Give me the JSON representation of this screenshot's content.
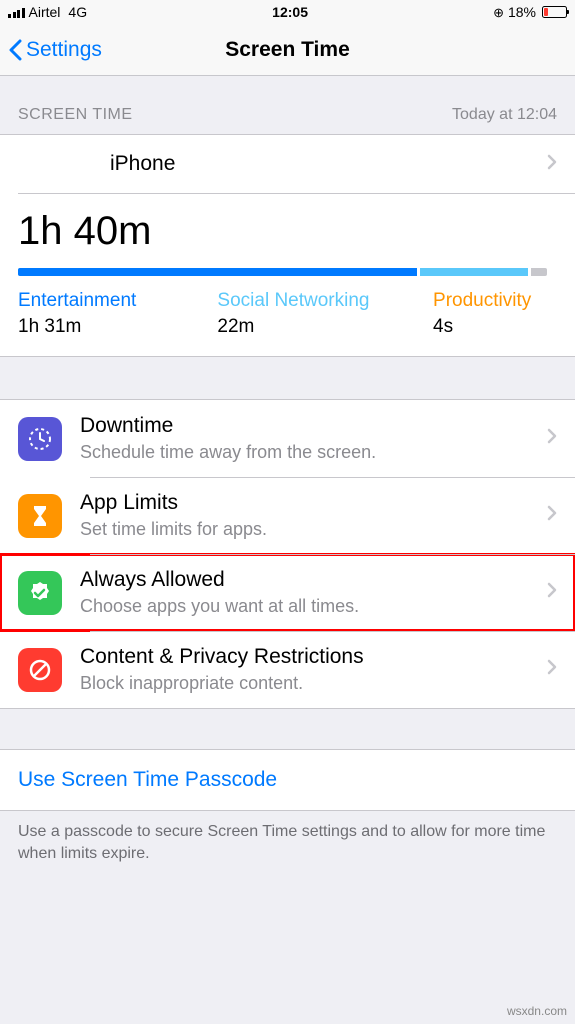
{
  "status": {
    "carrier": "Airtel",
    "network": "4G",
    "time": "12:05",
    "battery_pct": "18%"
  },
  "nav": {
    "back_label": "Settings",
    "title": "Screen Time"
  },
  "summary": {
    "header_left": "SCREEN TIME",
    "header_right": "Today at 12:04",
    "device": "iPhone",
    "total": "1h 40m",
    "categories": [
      {
        "label": "Entertainment",
        "value": "1h 31m",
        "color": "#007aff",
        "pct": 74
      },
      {
        "label": "Social Networking",
        "value": "22m",
        "color": "#5ac8fa",
        "pct": 20
      },
      {
        "label": "Productivity",
        "value": "4s",
        "color": "#c7c7cc",
        "pct": 3
      }
    ]
  },
  "menu": {
    "downtime": {
      "title": "Downtime",
      "sub": "Schedule time away from the screen."
    },
    "applimits": {
      "title": "App Limits",
      "sub": "Set time limits for apps."
    },
    "always": {
      "title": "Always Allowed",
      "sub": "Choose apps you want at all times."
    },
    "content": {
      "title": "Content & Privacy Restrictions",
      "sub": "Block inappropriate content."
    }
  },
  "passcode": {
    "link": "Use Screen Time Passcode",
    "note": "Use a passcode to secure Screen Time settings and to allow for more time when limits expire."
  },
  "watermark": "wsxdn.com",
  "colors": {
    "accent": "#007aff",
    "orange": "#ff9500",
    "green": "#34c759",
    "red": "#ff3b30",
    "purple": "#5856d6"
  }
}
